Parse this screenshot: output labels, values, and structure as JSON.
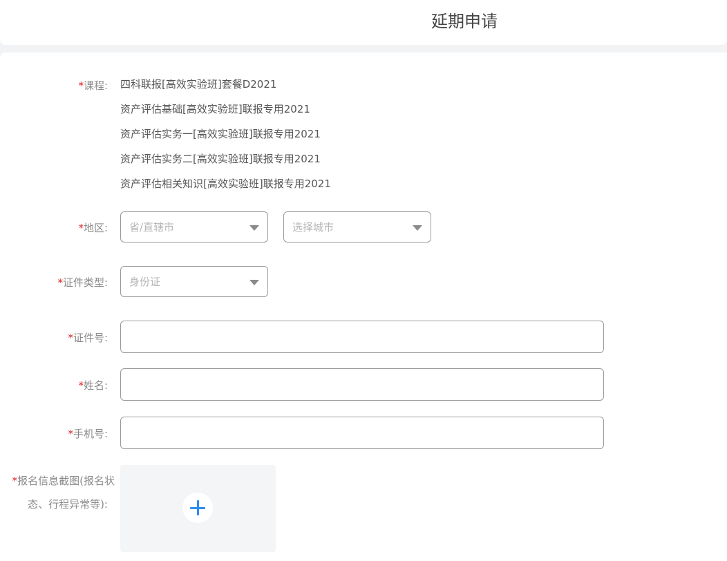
{
  "header": {
    "title": "延期申请"
  },
  "form": {
    "course": {
      "label": "课程:",
      "required_mark": "*",
      "items": [
        "四科联报[高效实验班]套餐D2021",
        "资产评估基础[高效实验班]联报专用2021",
        "资产评估实务一[高效实验班]联报专用2021",
        "资产评估实务二[高效实验班]联报专用2021",
        "资产评估相关知识[高效实验班]联报专用2021"
      ]
    },
    "region": {
      "label": "地区:",
      "required_mark": "*",
      "province_placeholder": "省/直辖市",
      "city_placeholder": "选择城市"
    },
    "id_type": {
      "label": "证件类型:",
      "required_mark": "*",
      "value": "身份证"
    },
    "id_number": {
      "label": "证件号:",
      "required_mark": "*",
      "value": ""
    },
    "name": {
      "label": "姓名:",
      "required_mark": "*",
      "value": ""
    },
    "phone": {
      "label": "手机号:",
      "required_mark": "*",
      "value": ""
    },
    "screenshot": {
      "required_mark": "*",
      "label_line1": "报名信息截图(报名状",
      "label_line2": "态、行程异常等):",
      "upload_icon": "plus-icon",
      "accent_color": "#2b8cf0"
    }
  }
}
